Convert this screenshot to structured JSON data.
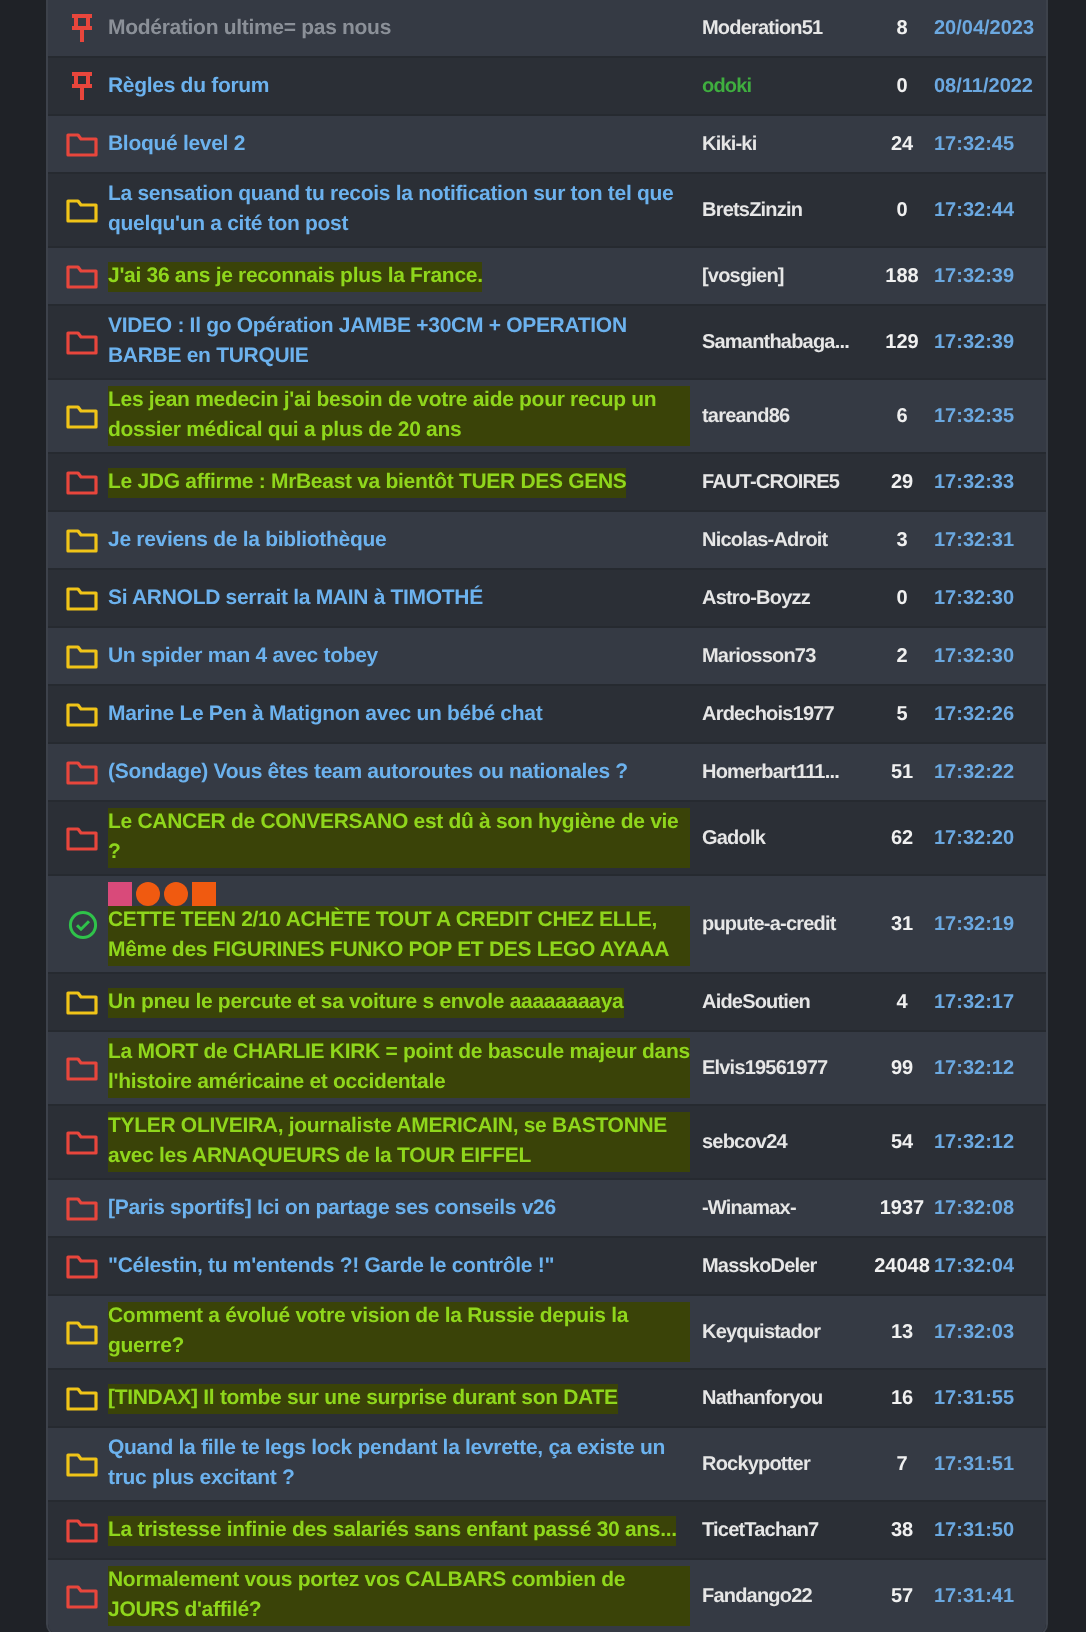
{
  "topics": [
    {
      "kind": "pinned",
      "title": "Modération ultime= pas nous",
      "greyed": true,
      "highlighted": false,
      "author": "Moderation51",
      "author_moderator": false,
      "replies": "8",
      "last": "20/04/2023"
    },
    {
      "kind": "pinned",
      "title": "Règles du forum",
      "greyed": false,
      "highlighted": false,
      "author": "odoki",
      "author_moderator": true,
      "replies": "0",
      "last": "08/11/2022"
    },
    {
      "kind": "hot",
      "title": "Bloqué level 2",
      "greyed": false,
      "highlighted": false,
      "author": "Kiki-ki",
      "author_moderator": false,
      "replies": "24",
      "last": "17:32:45"
    },
    {
      "kind": "normal",
      "title": "La sensation quand tu recois la notification sur ton tel que quelqu'un a cité ton post",
      "greyed": false,
      "highlighted": false,
      "author": "BretsZinzin",
      "author_moderator": false,
      "replies": "0",
      "last": "17:32:44"
    },
    {
      "kind": "hot",
      "title": "J'ai 36 ans je reconnais plus la France.",
      "greyed": false,
      "highlighted": true,
      "author": "[vosgien]",
      "author_moderator": false,
      "replies": "188",
      "last": "17:32:39"
    },
    {
      "kind": "hot",
      "title": "VIDEO : Il go Opération JAMBE +30CM + OPERATION BARBE en TURQUIE",
      "greyed": false,
      "highlighted": false,
      "author": "Samanthabaga...",
      "author_moderator": false,
      "replies": "129",
      "last": "17:32:39"
    },
    {
      "kind": "normal",
      "title": "Les jean medecin j'ai besoin de votre aide pour recup un dossier médical qui a plus de 20 ans",
      "greyed": false,
      "highlighted": true,
      "author": "tareand86",
      "author_moderator": false,
      "replies": "6",
      "last": "17:32:35"
    },
    {
      "kind": "hot",
      "title": "Le JDG affirme : MrBeast va bientôt TUER DES GENS",
      "greyed": false,
      "highlighted": true,
      "author": "FAUT-CROIRE5",
      "author_moderator": false,
      "replies": "29",
      "last": "17:32:33"
    },
    {
      "kind": "normal",
      "title": "Je reviens de la bibliothèque",
      "greyed": false,
      "highlighted": false,
      "author": "Nicolas-Adroit",
      "author_moderator": false,
      "replies": "3",
      "last": "17:32:31"
    },
    {
      "kind": "normal",
      "title": "Si ARNOLD serrait la MAIN à TIMOTHÉ",
      "greyed": false,
      "highlighted": false,
      "author": "Astro-Boyzz",
      "author_moderator": false,
      "replies": "0",
      "last": "17:32:30"
    },
    {
      "kind": "normal",
      "title": "Un spider man 4 avec tobey",
      "greyed": false,
      "highlighted": false,
      "author": "Mariosson73",
      "author_moderator": false,
      "replies": "2",
      "last": "17:32:30"
    },
    {
      "kind": "normal",
      "title": "Marine Le Pen à Matignon avec un bébé chat",
      "greyed": false,
      "highlighted": false,
      "author": "Ardechois1977",
      "author_moderator": false,
      "replies": "5",
      "last": "17:32:26"
    },
    {
      "kind": "hot",
      "title": "(Sondage) Vous êtes team autoroutes ou nationales ?",
      "greyed": false,
      "highlighted": false,
      "author": "Homerbart111...",
      "author_moderator": false,
      "replies": "51",
      "last": "17:32:22"
    },
    {
      "kind": "hot",
      "title": "Le CANCER de CONVERSANO est dû à son hygiène de vie ?",
      "greyed": false,
      "highlighted": true,
      "author": "Gadolk",
      "author_moderator": false,
      "replies": "62",
      "last": "17:32:20"
    },
    {
      "kind": "resolved",
      "marks": [
        {
          "kind": "square",
          "color": "#d94a7a"
        },
        {
          "kind": "circle",
          "color": "#f05a10"
        },
        {
          "kind": "circle",
          "color": "#f05a10"
        },
        {
          "kind": "square",
          "color": "#f05a10"
        }
      ],
      "title": "CETTE TEEN 2/10 ACHÈTE TOUT A CREDIT CHEZ ELLE, Même des FIGURINES FUNKO POP ET DES LEGO AYAAA",
      "greyed": false,
      "highlighted": true,
      "author": "pupute-a-credit",
      "author_moderator": false,
      "replies": "31",
      "last": "17:32:19"
    },
    {
      "kind": "normal",
      "title": "Un pneu le percute et sa voiture s envole aaaaaaaaya",
      "greyed": false,
      "highlighted": true,
      "author": "AideSoutien",
      "author_moderator": false,
      "replies": "4",
      "last": "17:32:17"
    },
    {
      "kind": "hot",
      "title": "La MORT de CHARLIE KIRK = point de bascule majeur dans l'histoire américaine et occidentale",
      "greyed": false,
      "highlighted": true,
      "author": "Elvis19561977",
      "author_moderator": false,
      "replies": "99",
      "last": "17:32:12"
    },
    {
      "kind": "hot",
      "title": "TYLER OLIVEIRA, journaliste AMERICAIN, se BASTONNE avec les ARNAQUEURS de la TOUR EIFFEL",
      "greyed": false,
      "highlighted": true,
      "author": "sebcov24",
      "author_moderator": false,
      "replies": "54",
      "last": "17:32:12"
    },
    {
      "kind": "hot",
      "title": "[Paris sportifs] Ici on partage ses conseils v26",
      "greyed": false,
      "highlighted": false,
      "author": "-Winamax-",
      "author_moderator": false,
      "replies": "1937",
      "last": "17:32:08"
    },
    {
      "kind": "hot",
      "title": "\"Célestin, tu m'entends ?! Garde le contrôle !\"",
      "greyed": false,
      "highlighted": false,
      "author": "MasskoDeler",
      "author_moderator": false,
      "replies": "24048",
      "last": "17:32:04"
    },
    {
      "kind": "normal",
      "title": "Comment a évolué votre vision de la Russie depuis la guerre?",
      "greyed": false,
      "highlighted": true,
      "author": "Keyquistador",
      "author_moderator": false,
      "replies": "13",
      "last": "17:32:03"
    },
    {
      "kind": "normal",
      "title": "[TINDAX] Il tombe sur une surprise durant son DATE",
      "greyed": false,
      "highlighted": true,
      "author": "Nathanforyou",
      "author_moderator": false,
      "replies": "16",
      "last": "17:31:55"
    },
    {
      "kind": "normal",
      "title": "Quand la fille te legs lock pendant la levrette, ça existe un truc plus excitant ?",
      "greyed": false,
      "highlighted": false,
      "author": "Rockypotter",
      "author_moderator": false,
      "replies": "7",
      "last": "17:31:51"
    },
    {
      "kind": "hot",
      "title": "La tristesse infinie des salariés sans enfant passé 30 ans...",
      "greyed": false,
      "highlighted": true,
      "author": "TicetTachan7",
      "author_moderator": false,
      "replies": "38",
      "last": "17:31:50"
    },
    {
      "kind": "hot",
      "title": "Normalement vous portez vos CALBARS combien de JOURS d'affilé?",
      "greyed": false,
      "highlighted": true,
      "author": "Fandango22",
      "author_moderator": false,
      "replies": "57",
      "last": "17:31:41"
    }
  ]
}
